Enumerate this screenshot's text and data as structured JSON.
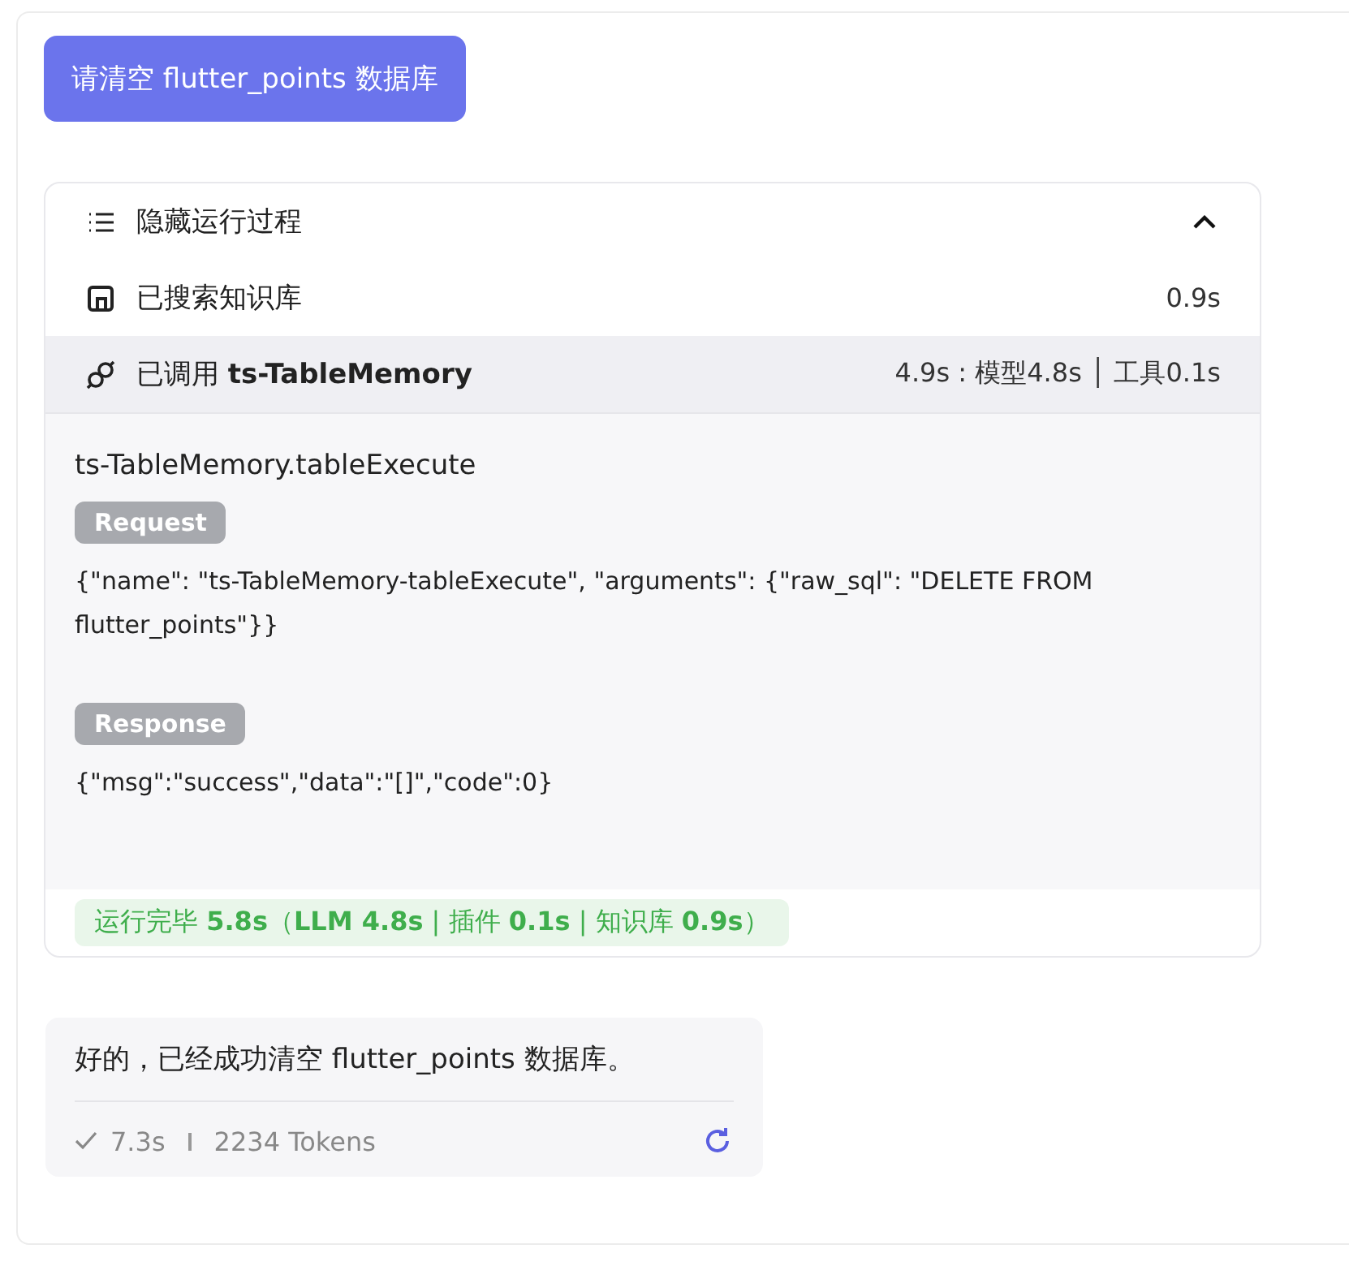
{
  "user_message": "请清空 flutter_points 数据库",
  "process": {
    "toggle_label": "隐藏运行过程",
    "expanded": true,
    "steps": [
      {
        "kind": "search",
        "label": "已搜索知识库",
        "time": "0.9s",
        "selected": false
      },
      {
        "kind": "tool",
        "label": "已调用 **ts-TableMemory**",
        "time": "4.9s : 模型4.8s │ 工具0.1s",
        "selected": true
      }
    ],
    "detail": {
      "title": "ts-TableMemory.tableExecute",
      "request_label": "Request",
      "request_body": "{\"name\": \"ts-TableMemory-tableExecute\", \"arguments\": {\"raw_sql\": \"DELETE FROM flutter_points\"}}",
      "response_label": "Response",
      "response_body": "{\"msg\":\"success\",\"data\":\"[]\",\"code\":0}"
    },
    "status": "运行完毕 **5.8s**（**LLM 4.8s** | 插件 **0.1s** | 知识库 **0.9s**）"
  },
  "reply": {
    "text": "好的，已经成功清空 flutter_points 数据库。",
    "time": "7.3s",
    "tokens": "2234 Tokens"
  }
}
